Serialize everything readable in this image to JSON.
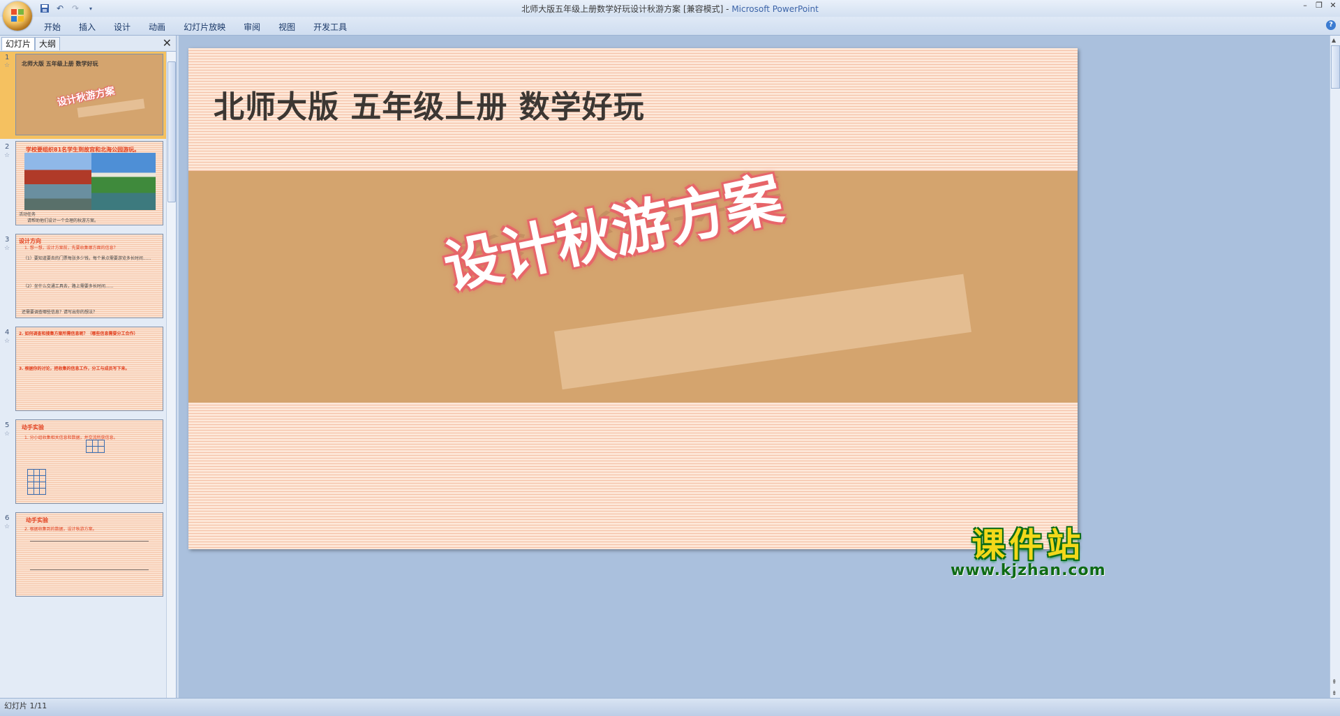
{
  "window": {
    "title": "北师大版五年级上册数学好玩设计秋游方案 [兼容模式] - ",
    "app_name": "Microsoft PowerPoint",
    "controls": [
      "–",
      "❐",
      "✕"
    ]
  },
  "ribbon": {
    "tabs": [
      "开始",
      "插入",
      "设计",
      "动画",
      "幻灯片放映",
      "审阅",
      "视图",
      "开发工具"
    ]
  },
  "left_pane": {
    "tabs": [
      "幻灯片",
      "大纲"
    ],
    "close": "✕",
    "thumbnails": [
      {
        "num": "1",
        "title": "北师大版 五年级上册 数学好玩",
        "art": "设计秋游方案"
      },
      {
        "num": "2",
        "title": "学校要组织81名学生到故宫和北海公园游玩。",
        "text1": "活动任务",
        "text2": "请帮助他们设计一个合理的秋游方案。"
      },
      {
        "num": "3",
        "title": "设计方向",
        "text1": "1. 想一想，设计方案前，先要收集哪方面的信息？",
        "text2": "（1）要知道要去的门票每张多少钱，每个景点需要游览多长时间......",
        "text3": "（2）坐什么交通工具去，路上需要多长时间......",
        "text4": "还需要调查哪些信息？请写出你的想法？"
      },
      {
        "num": "4",
        "title": "2. 如何调查和搜集方案所需信息呢？（哪些信息需要分工合作）",
        "text1": "3. 根据你的讨论，把收集的信息工作，分工与成员写下来。"
      },
      {
        "num": "5",
        "title": "动手实验",
        "text1": "1. 分小组收集相关信息和数据，并交流所获信息。"
      },
      {
        "num": "6",
        "title": "动手实验",
        "text1": "2. 根据收集到的数据，设计秋游方案。"
      }
    ]
  },
  "slide": {
    "title": "北师大版 五年级上册 数学好玩",
    "wordart": "设计秋游方案"
  },
  "watermark": {
    "cn": "课件站",
    "url": "www.kjzhan.com"
  },
  "status": {
    "text": "幻灯片 1/11"
  }
}
